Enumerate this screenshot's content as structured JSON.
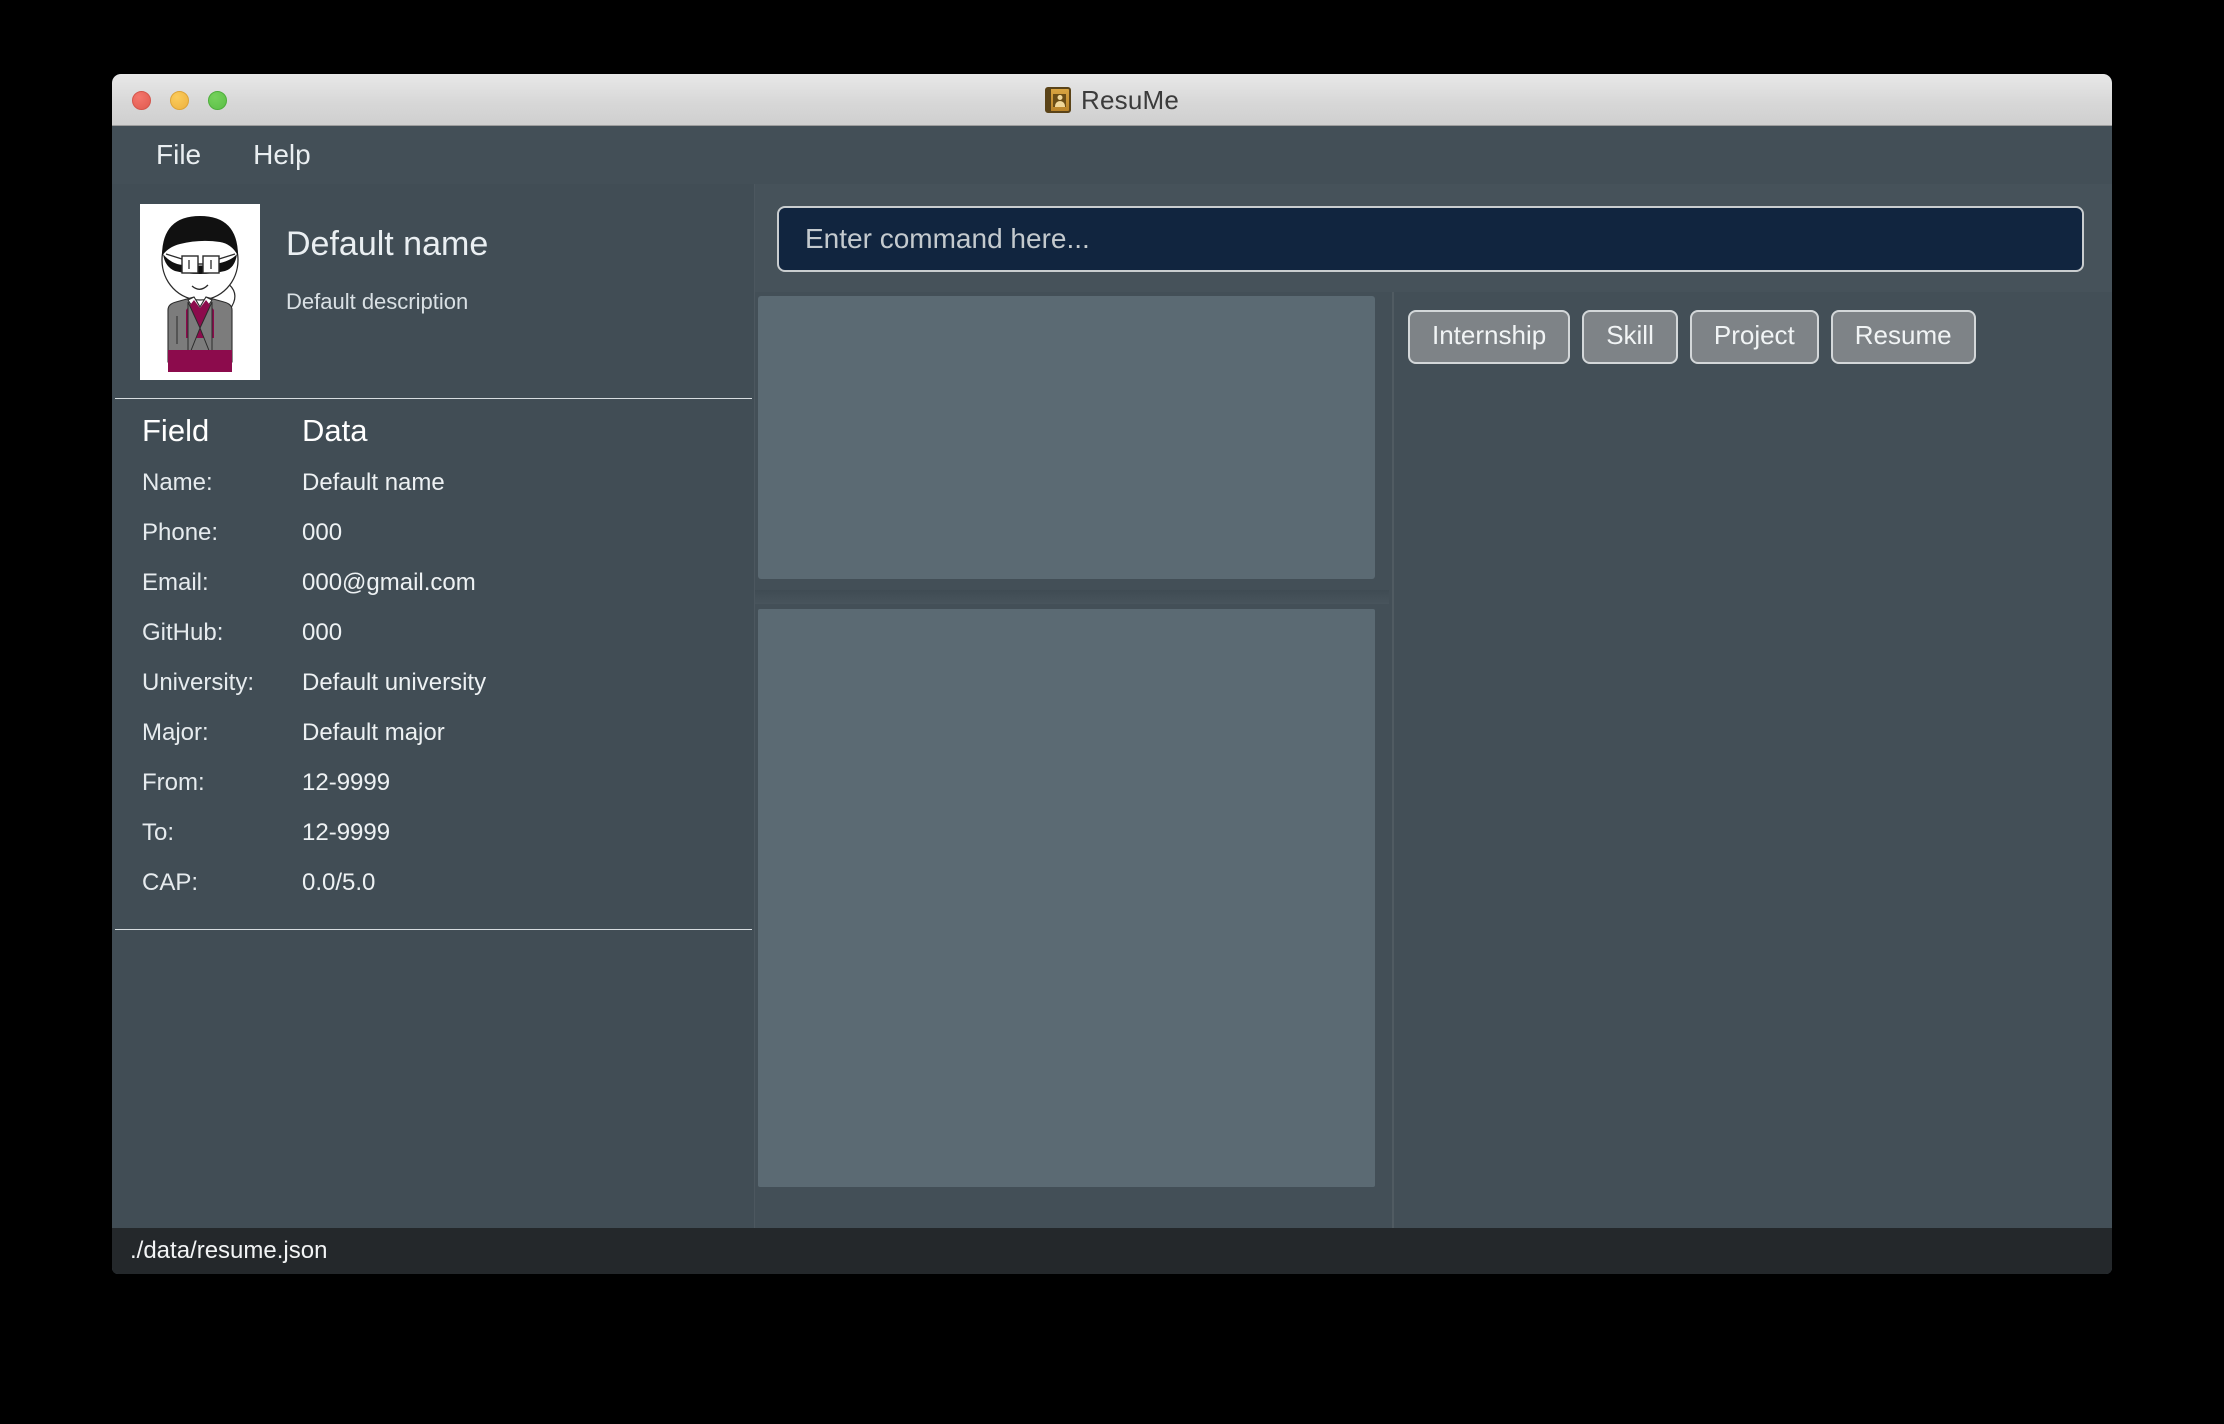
{
  "window": {
    "title": "ResuMe",
    "app_icon": "address-book-icon",
    "traffic_lights": {
      "close": "close-button",
      "minimize": "minimize-button",
      "maximize": "maximize-button",
      "close_color": "#e05a4f",
      "minimize_color": "#edb140",
      "maximize_color": "#5bbf46"
    }
  },
  "menubar": {
    "items": [
      {
        "label": "File",
        "name": "menu-file"
      },
      {
        "label": "Help",
        "name": "menu-help"
      }
    ]
  },
  "sidebar": {
    "profile": {
      "avatar_alt": "default-avatar",
      "name": "Default name",
      "description": "Default description"
    },
    "table": {
      "headers": {
        "field": "Field",
        "data": "Data"
      },
      "rows": [
        {
          "field": "Name:",
          "value": "Default name"
        },
        {
          "field": "Phone:",
          "value": "000"
        },
        {
          "field": "Email:",
          "value": "000@gmail.com"
        },
        {
          "field": "GitHub:",
          "value": "000"
        },
        {
          "field": "University:",
          "value": "Default university"
        },
        {
          "field": "Major:",
          "value": "Default major"
        },
        {
          "field": "From:",
          "value": "12-9999"
        },
        {
          "field": "To:",
          "value": "12-9999"
        },
        {
          "field": "CAP:",
          "value": "0.0/5.0"
        }
      ]
    }
  },
  "main": {
    "command": {
      "placeholder": "Enter command here...",
      "value": "",
      "background": "#11253f"
    },
    "panels": [
      {
        "name": "result-panel-top",
        "content": "",
        "fill": "#5b6a73"
      },
      {
        "name": "result-panel-bottom",
        "content": "",
        "fill": "#5b6a73"
      }
    ],
    "buttons": [
      {
        "label": "Internship",
        "name": "internship-button"
      },
      {
        "label": "Skill",
        "name": "skill-button"
      },
      {
        "label": "Project",
        "name": "project-button"
      },
      {
        "label": "Resume",
        "name": "resume-button"
      }
    ]
  },
  "statusbar": {
    "path": "./data/resume.json"
  },
  "theme": {
    "window_background": "#434f57",
    "sidebar_background": "#414d55",
    "panel_fill": "#5b6a73",
    "statusbar_background": "#24282b",
    "text_primary": "#eaeff2",
    "button_fill": "#7e8387",
    "button_border": "#d3d7d9"
  }
}
